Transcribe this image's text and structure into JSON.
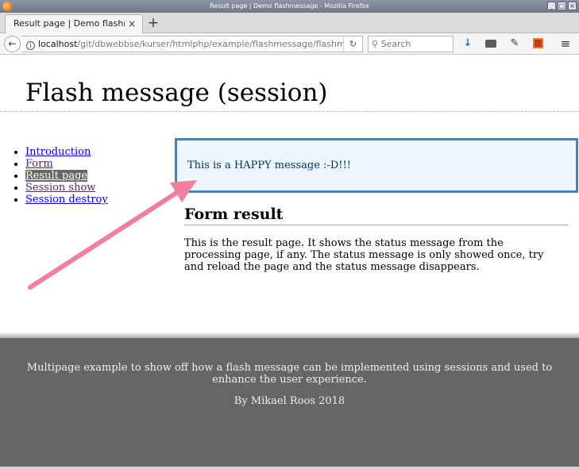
{
  "window": {
    "title": "Result page | Demo flashmessage - Mozilla Firefox"
  },
  "tabs": [
    {
      "title": "Result page | Demo flashm",
      "close": "×"
    }
  ],
  "new_tab_label": "+",
  "urlbar": {
    "host": "localhost",
    "path": "/git/dbwebbse/kurser/htmlphp/example/flashmessage/flashm"
  },
  "search": {
    "placeholder": "Search"
  },
  "page": {
    "site_title": "Flash message (session)",
    "nav": [
      {
        "label": "Introduction",
        "state": "link"
      },
      {
        "label": "Form",
        "state": "visited"
      },
      {
        "label": "Result page",
        "state": "selected"
      },
      {
        "label": "Session show",
        "state": "visited"
      },
      {
        "label": "Session destroy",
        "state": "link"
      }
    ],
    "flash_message": "This is a HAPPY message :-D!!!",
    "result_heading": "Form result",
    "result_text": "This is the result page. It shows the status message from the processing page, if any. The status message is only showed once, try and reload the page and the status message disappears."
  },
  "footer": {
    "description": "Multipage example to show off how a flash message can be implemented using sessions and used to enhance the user experience.",
    "byline": "By Mikael Roos 2018"
  },
  "colors": {
    "flash_border": "#4682b4",
    "flash_bg": "#eef6ff",
    "footer_bg": "#666666",
    "annotation_arrow": "#f0809c"
  },
  "icons": [
    "firefox-icon",
    "back-icon",
    "info-icon",
    "reload-icon",
    "search-icon",
    "download-icon",
    "developer-toolbar-icon",
    "eyedropper-icon",
    "addon-icon",
    "menu-icon",
    "annotation-arrow"
  ]
}
